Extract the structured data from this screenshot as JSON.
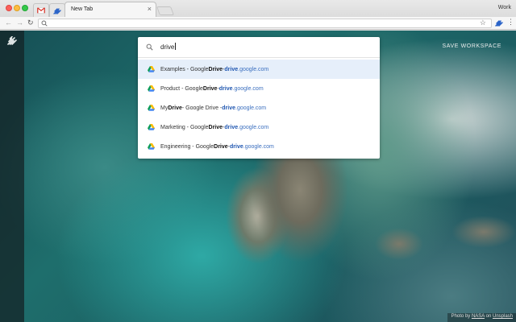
{
  "browser": {
    "profile": "Work",
    "active_tab_title": "New Tab",
    "tab_close": "×",
    "omnibox_value": ""
  },
  "sidebar": {
    "logo": "workona-logo"
  },
  "header": {
    "save_workspace": "SAVE WORKSPACE"
  },
  "search": {
    "query": "drive",
    "results": [
      {
        "prefix": "Examples - Google ",
        "bold": "Drive",
        "mid": " - ",
        "host_bold": "drive",
        "host_rest": ".google.com"
      },
      {
        "prefix": "Product - Google ",
        "bold": "Drive",
        "mid": " - ",
        "host_bold": "drive",
        "host_rest": ".google.com"
      },
      {
        "prefix": "My ",
        "bold": "Drive",
        "mid": " - Google Drive - ",
        "host_bold": "drive",
        "host_rest": ".google.com"
      },
      {
        "prefix": "Marketing - Google ",
        "bold": "Drive",
        "mid": " - ",
        "host_bold": "drive",
        "host_rest": ".google.com"
      },
      {
        "prefix": "Engineering - Google ",
        "bold": "Drive",
        "mid": " - ",
        "host_bold": "drive",
        "host_rest": ".google.com"
      }
    ]
  },
  "credit": {
    "prefix": "Photo by ",
    "author": "NASA",
    "mid": " on ",
    "site": "Unsplash"
  },
  "colors": {
    "accent": "#3b6fbf",
    "selected_row": "#e6effa",
    "sidebar": "#14232680"
  }
}
